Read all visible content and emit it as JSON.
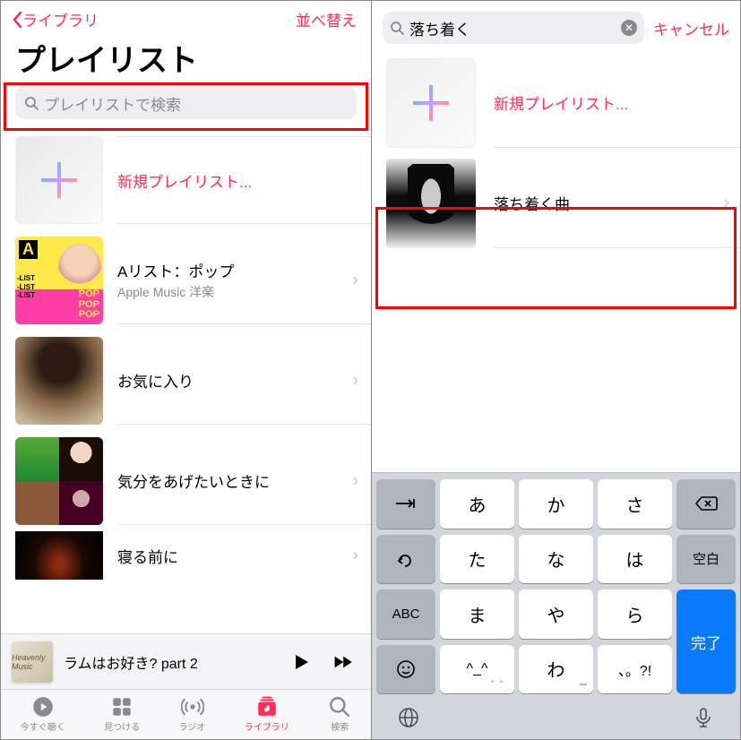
{
  "left": {
    "back_label": "ライブラリ",
    "sort_label": "並べ替え",
    "title": "プレイリスト",
    "search_placeholder": "プレイリストで検索",
    "new_playlist_label": "新規プレイリスト...",
    "items": [
      {
        "name": "Aリスト：ポップ",
        "sub": "Apple Music 洋楽"
      },
      {
        "name": "お気に入り",
        "sub": ""
      },
      {
        "name": "気分をあげたいときに",
        "sub": ""
      },
      {
        "name": "寝る前に",
        "sub": ""
      }
    ],
    "now_playing": {
      "title": "ラムはお好き? part 2",
      "art_text": "Heavenly Music"
    },
    "tabs": {
      "listen_now": "今すぐ聴く",
      "browse": "見つける",
      "radio": "ラジオ",
      "library": "ライブラリ",
      "search": "検索"
    }
  },
  "right": {
    "search_value": "落ち着く",
    "cancel_label": "キャンセル",
    "new_playlist_label": "新規プレイリスト...",
    "result_name": "落ち着く曲",
    "keyboard": {
      "tab": "→|",
      "undo": "↶",
      "abc": "ABC",
      "emoji": "☺",
      "space": "空白",
      "done": "完了",
      "backspace": "⌫",
      "rows": [
        [
          "あ",
          "か",
          "さ"
        ],
        [
          "た",
          "な",
          "は"
        ],
        [
          "ま",
          "や",
          "ら"
        ],
        [
          "^_^",
          "わ",
          "、。?!"
        ]
      ],
      "small_mark": "゛゜",
      "bar": "ー"
    }
  }
}
